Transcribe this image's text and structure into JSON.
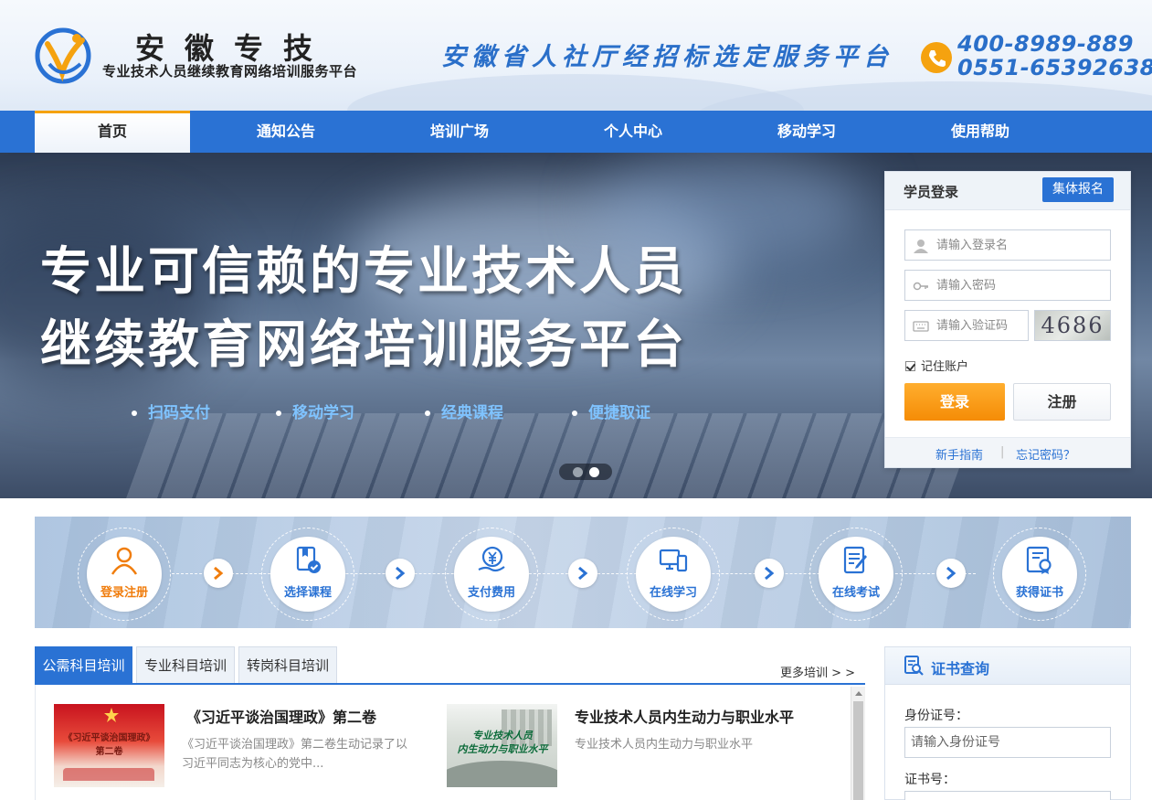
{
  "header": {
    "logo_title": "安徽专技",
    "logo_subtitle": "专业技术人员继续教育网络培训服务平台",
    "slogan": "安徽省人社厅经招标选定服务平台",
    "phone_1": "400-8989-889",
    "phone_2": "0551-65392638"
  },
  "nav": {
    "items": [
      "首页",
      "通知公告",
      "培训广场",
      "个人中心",
      "移动学习",
      "使用帮助"
    ],
    "active_index": 0
  },
  "banner": {
    "headline_1": "专业可信赖的专业技术人员",
    "headline_2": "继续教育网络培训服务平台",
    "features": [
      "扫码支付",
      "移动学习",
      "经典课程",
      "便捷取证"
    ],
    "slide_count": 2,
    "active_slide": 2
  },
  "login": {
    "title": "学员登录",
    "group_button": "集体报名",
    "username_placeholder": "请输入登录名",
    "password_placeholder": "请输入密码",
    "captcha_placeholder": "请输入验证码",
    "captcha_text": "4686",
    "remember_label": "记住账户",
    "remember_checked": true,
    "login_button": "登录",
    "register_button": "注册",
    "guide_link": "新手指南",
    "forgot_link": "忘记密码？",
    "separator": "|"
  },
  "process": {
    "steps": [
      "登录注册",
      "选择课程",
      "支付费用",
      "在线学习",
      "在线考试",
      "获得证书"
    ]
  },
  "training": {
    "tabs": [
      "公需科目培训",
      "专业科目培训",
      "转岗科目培训"
    ],
    "active_tab": 0,
    "more_link": "更多培训 > >",
    "courses": [
      {
        "title": "《习近平谈治国理政》第二卷",
        "description": "《习近平谈治国理政》第二卷生动记录了以习近平同志为核心的党中...",
        "thumb_text_1": "《习近平谈治国理政》",
        "thumb_text_2": "第二卷"
      },
      {
        "title": "专业技术人员内生动力与职业水平",
        "description": "专业技术人员内生动力与职业水平",
        "thumb_text_1": "专业技术人员",
        "thumb_text_2": "内生动力与职业水平"
      }
    ]
  },
  "cert": {
    "title": "证书查询",
    "id_label": "身份证号：",
    "id_placeholder": "请输入身份证号",
    "cert_label": "证书号："
  },
  "colors": {
    "brand_blue": "#2a72d4",
    "accent_orange": "#f58c06",
    "link_blue": "#7fc3ff"
  }
}
